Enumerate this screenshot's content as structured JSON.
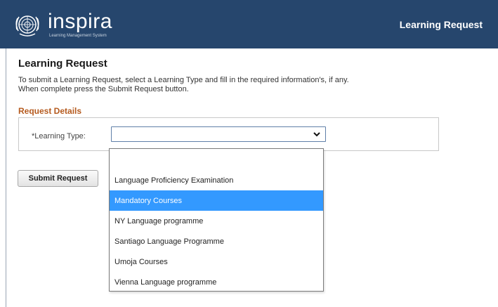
{
  "header": {
    "brand_name": "inspira",
    "brand_subtitle": "Learning Management System",
    "page_title": "Learning Request",
    "bg_color": "#26466d"
  },
  "main": {
    "title": "Learning Request",
    "instructions": "To submit a Learning Request, select a Learning Type and fill in the required information's, if any. When complete press the Submit Request button.",
    "section_title": "Request Details",
    "section_title_color": "#b55a1e",
    "learning_type_label": "*Learning Type:",
    "learning_type_value": "",
    "submit_label": "Submit Request"
  },
  "dropdown": {
    "options": [
      "",
      "Language Proficiency Examination",
      "Mandatory Courses",
      "NY Language programme",
      "Santiago Language Programme",
      "Umoja Courses",
      "Vienna Language programme"
    ],
    "highlighted_index": 2,
    "highlight_color": "#3399ff"
  },
  "icons": {
    "logo": "un-emblem-icon",
    "select_arrow": "chevron-down-icon"
  }
}
